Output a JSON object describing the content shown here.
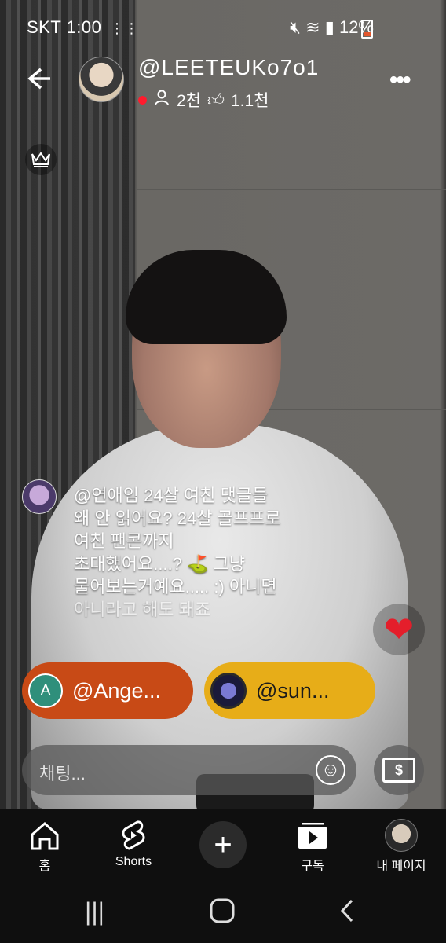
{
  "status_bar": {
    "carrier_time": "SKT 1:00",
    "battery_percent": "12%",
    "icons": [
      "footprints-icon",
      "mute-icon",
      "wifi-icon",
      "signal-icon",
      "battery-icon"
    ]
  },
  "header": {
    "channel_name": "@LEETEUKo7o1",
    "viewers": "2천",
    "likes": "1.1천",
    "live_indicator_color": "#ff1b2d"
  },
  "chat_message": {
    "text_lines": [
      "@연애임   24살 여친 댓글들",
      "왜 안 읽어요? 24살 골프프로",
      "여친 팬콘까지",
      "초대했어요....? ⛳ 그냥",
      "물어보는거예요..... :) 아니면",
      "아니라고 해도 돼죠"
    ]
  },
  "pills": [
    {
      "avatar_letter": "A",
      "label": "@Ange...",
      "color": "#c84a16"
    },
    {
      "avatar_letter": "",
      "label": "@sun...",
      "color": "#e7ad18"
    }
  ],
  "chat_input": {
    "placeholder": "채팅..."
  },
  "bottom_nav": {
    "items": [
      {
        "label": "홈",
        "icon": "home-icon"
      },
      {
        "label": "Shorts",
        "icon": "shorts-icon"
      },
      {
        "label": "",
        "icon": "create-icon"
      },
      {
        "label": "구독",
        "icon": "subscriptions-icon"
      },
      {
        "label": "내 페이지",
        "icon": "profile-avatar"
      }
    ]
  }
}
